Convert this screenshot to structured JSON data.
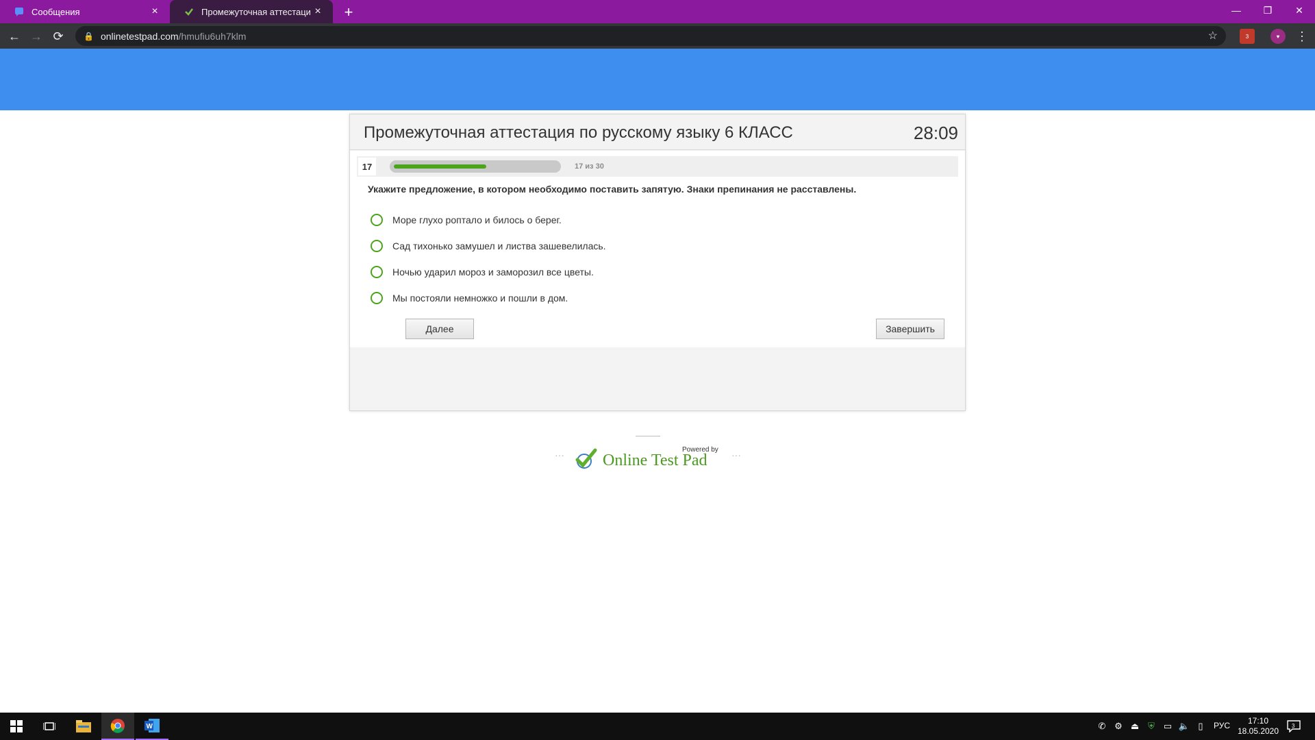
{
  "browser": {
    "tabs": [
      {
        "title": "Сообщения",
        "active": false,
        "favicon": "messages-icon"
      },
      {
        "title": "Промежуточная аттестация по",
        "active": true,
        "favicon": "onlinetestpad-icon"
      }
    ],
    "url_host": "onlinetestpad.com",
    "url_path": "/hmufiu6uh7klm",
    "extension_badge": "3"
  },
  "test": {
    "title": "Промежуточная аттестация по русскому языку 6 КЛАСС",
    "timer": "28:09",
    "question_number": "17",
    "progress_text": "17 из 30",
    "progress_fraction": 0.5667,
    "question": "Укажите предложение, в котором необходимо поставить запятую. Знаки препинания не расставлены.",
    "answers": [
      "Море глухо роптало и билось о берег.",
      "Сад тихонько замушел и листва зашевелилась.",
      "Ночью ударил мороз и заморозил все цветы.",
      "Мы постояли немножко и пошли в дом."
    ],
    "next_label": "Далее",
    "finish_label": "Завершить"
  },
  "footer": {
    "powered_by": "Powered by",
    "brand": "Online Test Pad"
  },
  "taskbar": {
    "language": "РУС",
    "time": "17:10",
    "date": "18.05.2020",
    "notification_count": "3"
  },
  "colors": {
    "tab_bar": "#8b1a9f",
    "header_band": "#3e8ef0",
    "accent_green": "#4ca41c"
  }
}
